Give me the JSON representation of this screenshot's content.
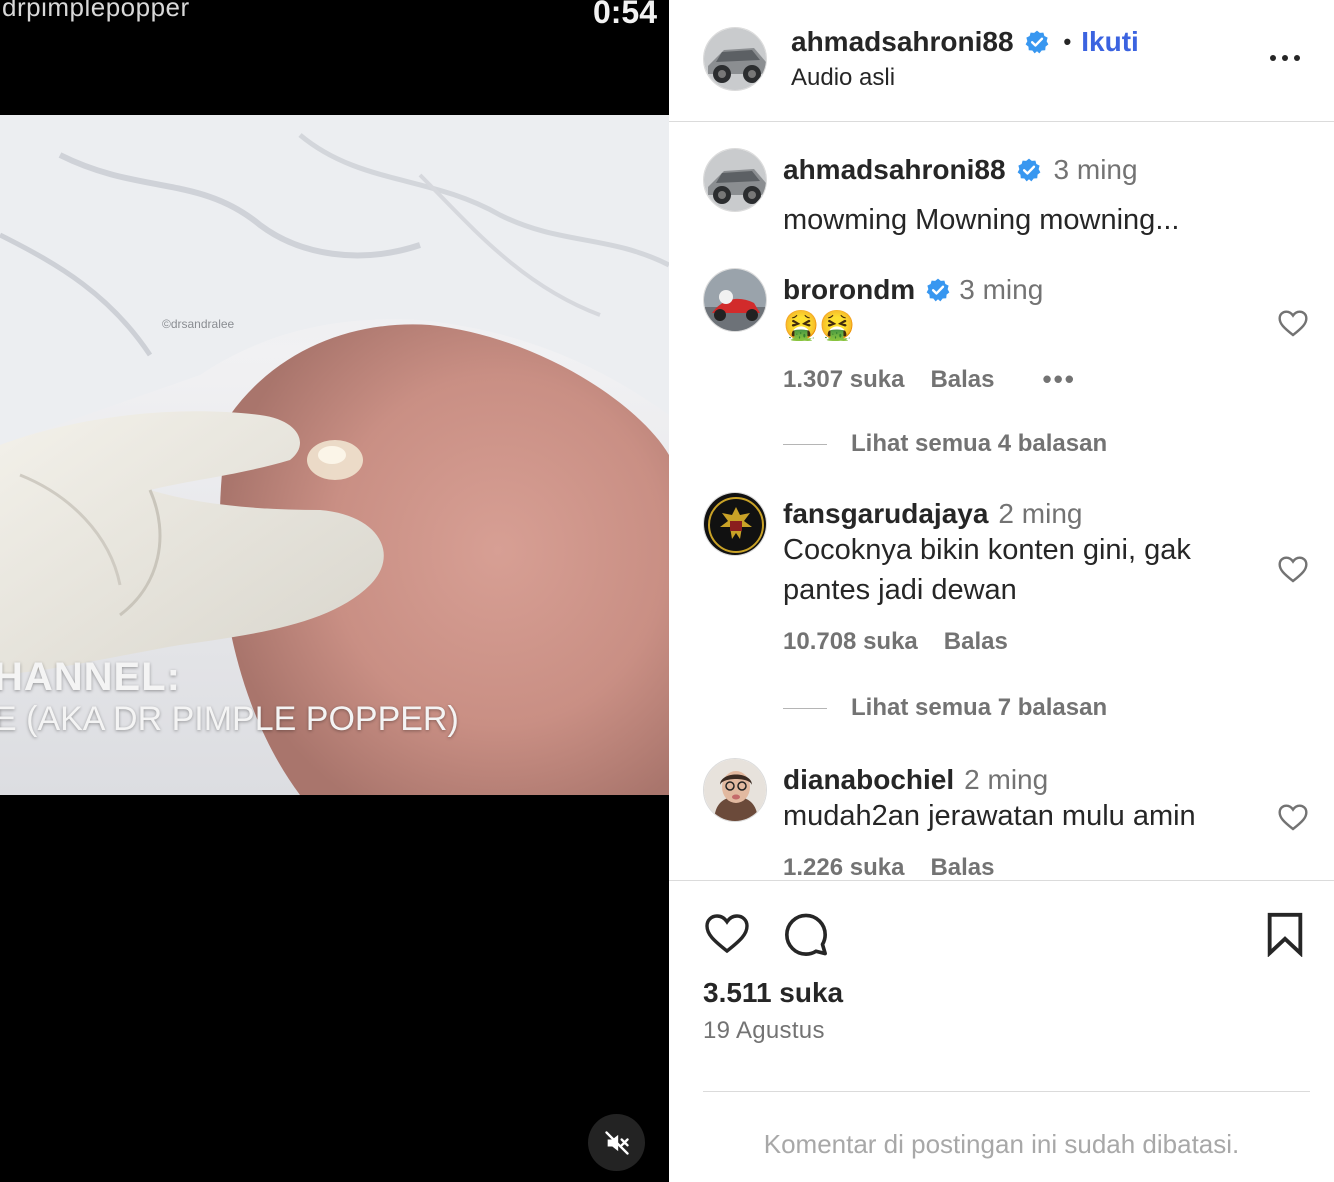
{
  "video": {
    "handle_overlay": "drpimplepopper",
    "timer": "0:54",
    "watermark": "©drsandralee",
    "caption_line1": "HANNEL:",
    "caption_line2": "E (AKA DR PIMPLE POPPER)",
    "mute_icon": "speaker-muted-icon"
  },
  "header": {
    "username": "ahmadsahroni88",
    "dot": "•",
    "follow": "Ikuti",
    "audio": "Audio asli"
  },
  "caption": {
    "username": "ahmadsahroni88",
    "time": "3 ming",
    "text": "mowming Mowning mowning..."
  },
  "comments": [
    {
      "username": "brorondm",
      "time": "3 ming",
      "text": "🤮🤮",
      "likes": "1.307 suka",
      "reply": "Balas",
      "more": "•••",
      "view_replies": "Lihat semua 4 balasan"
    },
    {
      "username": "fansgarudajaya",
      "time": "2 ming",
      "text": "Cocoknya bikin konten gini, gak pantes jadi dewan",
      "likes": "10.708 suka",
      "reply": "Balas",
      "view_replies": "Lihat semua 7 balasan"
    },
    {
      "username": "dianabochiel",
      "time": "2 ming",
      "text": "mudah2an jerawatan mulu amin",
      "likes": "1.226 suka",
      "reply": "Balas"
    }
  ],
  "footer": {
    "likes": "3.511 suka",
    "date": "19 Agustus",
    "comments_limited": "Komentar di postingan ini sudah dibatasi."
  },
  "colors": {
    "link": "#3b63e0",
    "verified": "#3897f0",
    "muted_text": "#737373",
    "border": "#dbdbdb"
  }
}
